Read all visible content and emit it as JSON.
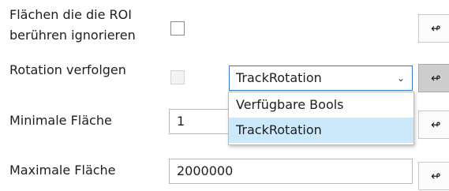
{
  "rows": [
    {
      "label_line1": "Flächen die die ROI",
      "label_line2": "berühren ignorieren",
      "button_icon": "arrow-left-dot-icon"
    },
    {
      "label": "Rotation verfolgen",
      "button_icon": "arrow-left-dot-icon"
    },
    {
      "label": "Minimale Fläche",
      "value": "1",
      "button_icon": "arrow-left-dot-icon"
    },
    {
      "label": "Maximale Fläche",
      "value": "2000000",
      "button_icon": "arrow-left-dot-icon"
    }
  ],
  "combo": {
    "selected": "TrackRotation",
    "options": [
      "Verfügbare Bools",
      "TrackRotation"
    ]
  },
  "glyphs": {
    "side_button": "↫",
    "chevron": "⌄"
  },
  "colors": {
    "combo_border": "#2f7ad1",
    "highlight": "#cce8fb"
  }
}
